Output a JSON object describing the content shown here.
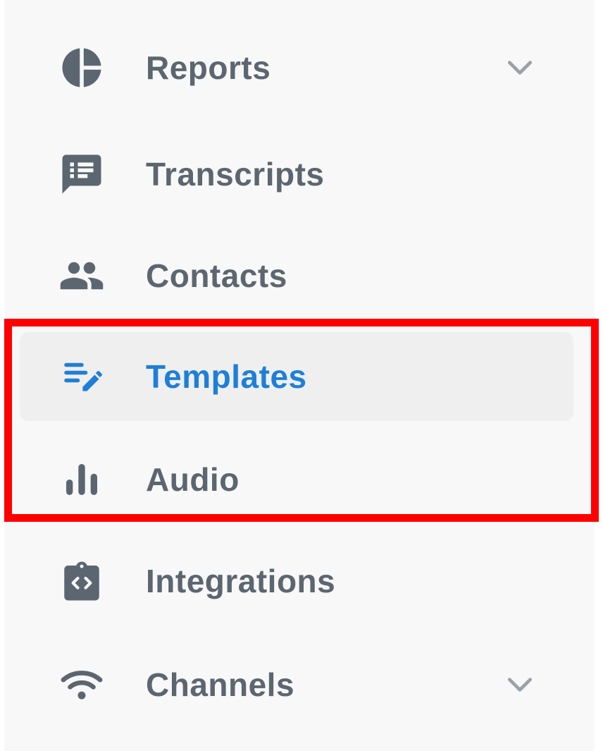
{
  "sidebar": {
    "items": [
      {
        "label": "Reports",
        "icon": "pie-chart-icon",
        "has_chevron": true,
        "active": false
      },
      {
        "label": "Transcripts",
        "icon": "chat-list-icon",
        "has_chevron": false,
        "active": false
      },
      {
        "label": "Contacts",
        "icon": "people-icon",
        "has_chevron": false,
        "active": false
      },
      {
        "label": "Templates",
        "icon": "edit-list-icon",
        "has_chevron": false,
        "active": true
      },
      {
        "label": "Audio",
        "icon": "bar-chart-icon",
        "has_chevron": false,
        "active": false
      },
      {
        "label": "Integrations",
        "icon": "code-clipboard-icon",
        "has_chevron": false,
        "active": false
      },
      {
        "label": "Channels",
        "icon": "wifi-icon",
        "has_chevron": true,
        "active": false
      }
    ]
  },
  "colors": {
    "sidebar_bg": "#f8f8f8",
    "active_bg": "#efefef",
    "text": "#5c6670",
    "icon": "#5c6670",
    "active_text": "#1e7fd8",
    "chevron": "#9aa2a9",
    "highlight": "#ff0000"
  }
}
